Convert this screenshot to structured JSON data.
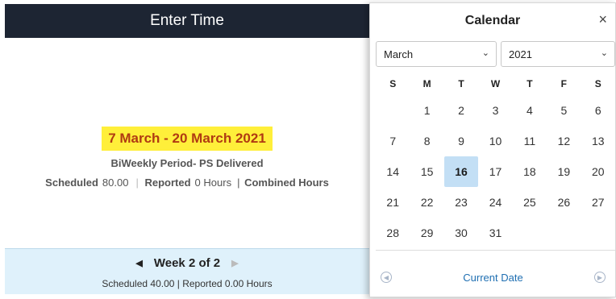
{
  "header": {
    "title": "Enter Time"
  },
  "period": {
    "title": "7 March - 20 March 2021",
    "subtitle": "BiWeekly Period- PS Delivered",
    "scheduled_label": "Scheduled",
    "scheduled_value": "80.00",
    "reported_label": "Reported",
    "reported_value": "0 Hours",
    "combined_label": "Combined Hours"
  },
  "week": {
    "label": "Week 2 of 2",
    "summary": "Scheduled 40.00 | Reported 0.00 Hours",
    "prev_icon": "triangle-left",
    "next_icon": "triangle-right"
  },
  "calendar": {
    "title": "Calendar",
    "close_icon": "×",
    "month": "March",
    "year": "2021",
    "weekdays": [
      "S",
      "M",
      "T",
      "W",
      "T",
      "F",
      "S"
    ],
    "weeks": [
      [
        "",
        "1",
        "2",
        "3",
        "4",
        "5",
        "6"
      ],
      [
        "7",
        "8",
        "9",
        "10",
        "11",
        "12",
        "13"
      ],
      [
        "14",
        "15",
        "16",
        "17",
        "18",
        "19",
        "20"
      ],
      [
        "21",
        "22",
        "23",
        "24",
        "25",
        "26",
        "27"
      ],
      [
        "28",
        "29",
        "30",
        "31",
        "",
        "",
        ""
      ]
    ],
    "selected_day": "16",
    "current_date_label": "Current Date",
    "prev_icon": "circle-arrow-left",
    "next_icon": "circle-arrow-right"
  },
  "colors": {
    "header_bg": "#1d2533",
    "highlight": "#ffef3a",
    "period_text": "#b03a12",
    "week_bar_bg": "#dff1fb",
    "selected_day_bg": "#c3dff5",
    "link": "#1f6fb2"
  }
}
